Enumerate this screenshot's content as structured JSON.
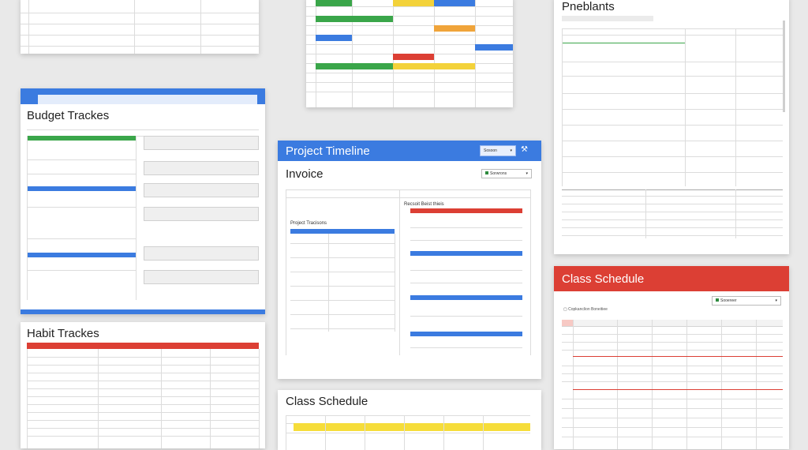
{
  "cards": {
    "budget": {
      "title": "Budget Trackes"
    },
    "habit": {
      "title": "Habit Trackes"
    },
    "timeline": {
      "header_title": "Project Timeline",
      "header_button": "Sosoon",
      "sub_title": "Invoice",
      "dropdown_label": "Sorwrons",
      "inner_title_left": "Project Tracisons",
      "inner_title_right": "Recsoit Beist thieis"
    },
    "enebl": {
      "title": "Pneblants"
    },
    "class_right": {
      "header_title": "Class Schedule",
      "dropdown_label": "Sooereer",
      "filter_label": "Copkanclion Boneitiee"
    },
    "class_bottom": {
      "title": "Class Schedule"
    }
  },
  "colors": {
    "blue": "#3b7be0",
    "green": "#3aa64a",
    "red": "#dc3f34",
    "yellow": "#f3d23a",
    "orange": "#f0a43a",
    "grid": "#d4d4d4"
  }
}
